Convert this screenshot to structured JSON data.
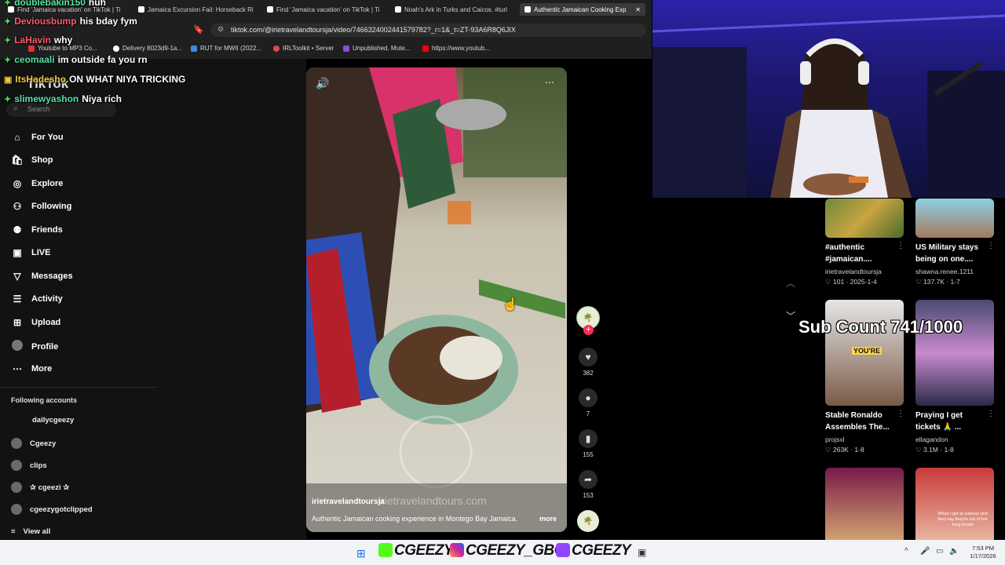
{
  "browser": {
    "tabs": [
      "Find 'Jamaica vacation' on TikTok | Ti",
      "Jamaica Excursion Fail: Horseback Ri",
      "Find 'Jamaica vacation' on TikTok | Ti",
      "Noah's Ark in Turks and Caicos. #turl",
      "Authentic Jamaican Cooking Exp"
    ],
    "url": "tiktok.com/@irietravelandtoursja/video/7466324002441579782?_r=1&_t=ZT-93A6R8Q6JIX",
    "bookmarks": [
      "Youtube to MP3 Co...",
      "Delivery 8023d9-1a...",
      "RUT for MWII (2022...",
      "IRLToolkit • Server",
      "Unpublished, Mute...",
      "https://www.youtub..."
    ]
  },
  "chat": [
    {
      "user": "doublebakin150",
      "msg": "huh"
    },
    {
      "user": "Deviousbump",
      "msg": "his bday fym"
    },
    {
      "user": "LaHavin",
      "msg": "why"
    },
    {
      "user": "ceomaali",
      "msg": "im outside fa you rn"
    },
    {
      "user": "ItsHadesho",
      "msg": "ON WHAT NIYA TRICKING"
    },
    {
      "user": "slimewyashon",
      "msg": "Niya rich"
    }
  ],
  "sidebar": {
    "logo": "TikTok",
    "search_placeholder": "Search",
    "nav": [
      "For You",
      "Shop",
      "Explore",
      "Following",
      "Friends",
      "LIVE",
      "Messages",
      "Activity",
      "Upload",
      "Profile",
      "More"
    ],
    "following_title": "Following accounts",
    "accounts": [
      "dailycgeezy",
      "Cgeezy",
      "clips",
      "✰ cgeezi ✰",
      "cgeezygotclipped"
    ],
    "view_all": "View all"
  },
  "video": {
    "author": "irietravelandtoursja",
    "watermark": "irietravelandtours.com",
    "caption": "Authentic Jamaican cooking experience in Montego Bay Jamaica.",
    "more": "more",
    "likes": "382",
    "comments": "7",
    "saves": "155",
    "shares": "153"
  },
  "overlay": {
    "sub_count": "Sub Count 741/1000"
  },
  "related": [
    {
      "title": "#authentic",
      "title2": "#jamaican....",
      "author": "irietravelandtoursja",
      "likes": "101",
      "date": "2025-1-4"
    },
    {
      "title": "US Military stays",
      "title2": "being on one....",
      "author": "shawna.renee.1211",
      "likes": "137.7K",
      "date": "1-7"
    },
    {
      "title": "Stable Ronaldo",
      "title2": "Assembles The...",
      "author": "projsxl",
      "likes": "263K",
      "date": "1-8",
      "thumb_text": "YOU'RE"
    },
    {
      "title": "Praying I get",
      "title2": "tickets 🙏 ...",
      "author": "ellagandon",
      "likes": "3.1M",
      "date": "1-8"
    },
    {
      "title": "",
      "title2": "",
      "author": "",
      "likes": "",
      "date": ""
    },
    {
      "title": "",
      "title2": "",
      "author": "",
      "likes": "",
      "date": "",
      "thumb_text": "When I get to subway and they say they're out of hot long bread"
    }
  ],
  "taskbar": {
    "socials": [
      "CGEEZY",
      "CGEEZY_GBC",
      "CGEEZY"
    ],
    "time": "7:53 PM",
    "date": "1/17/2026"
  },
  "colors": {
    "tiktok_red": "#fe2c55",
    "chat_user": "#58e2a6",
    "webcam_purple": "#2b22a8"
  }
}
